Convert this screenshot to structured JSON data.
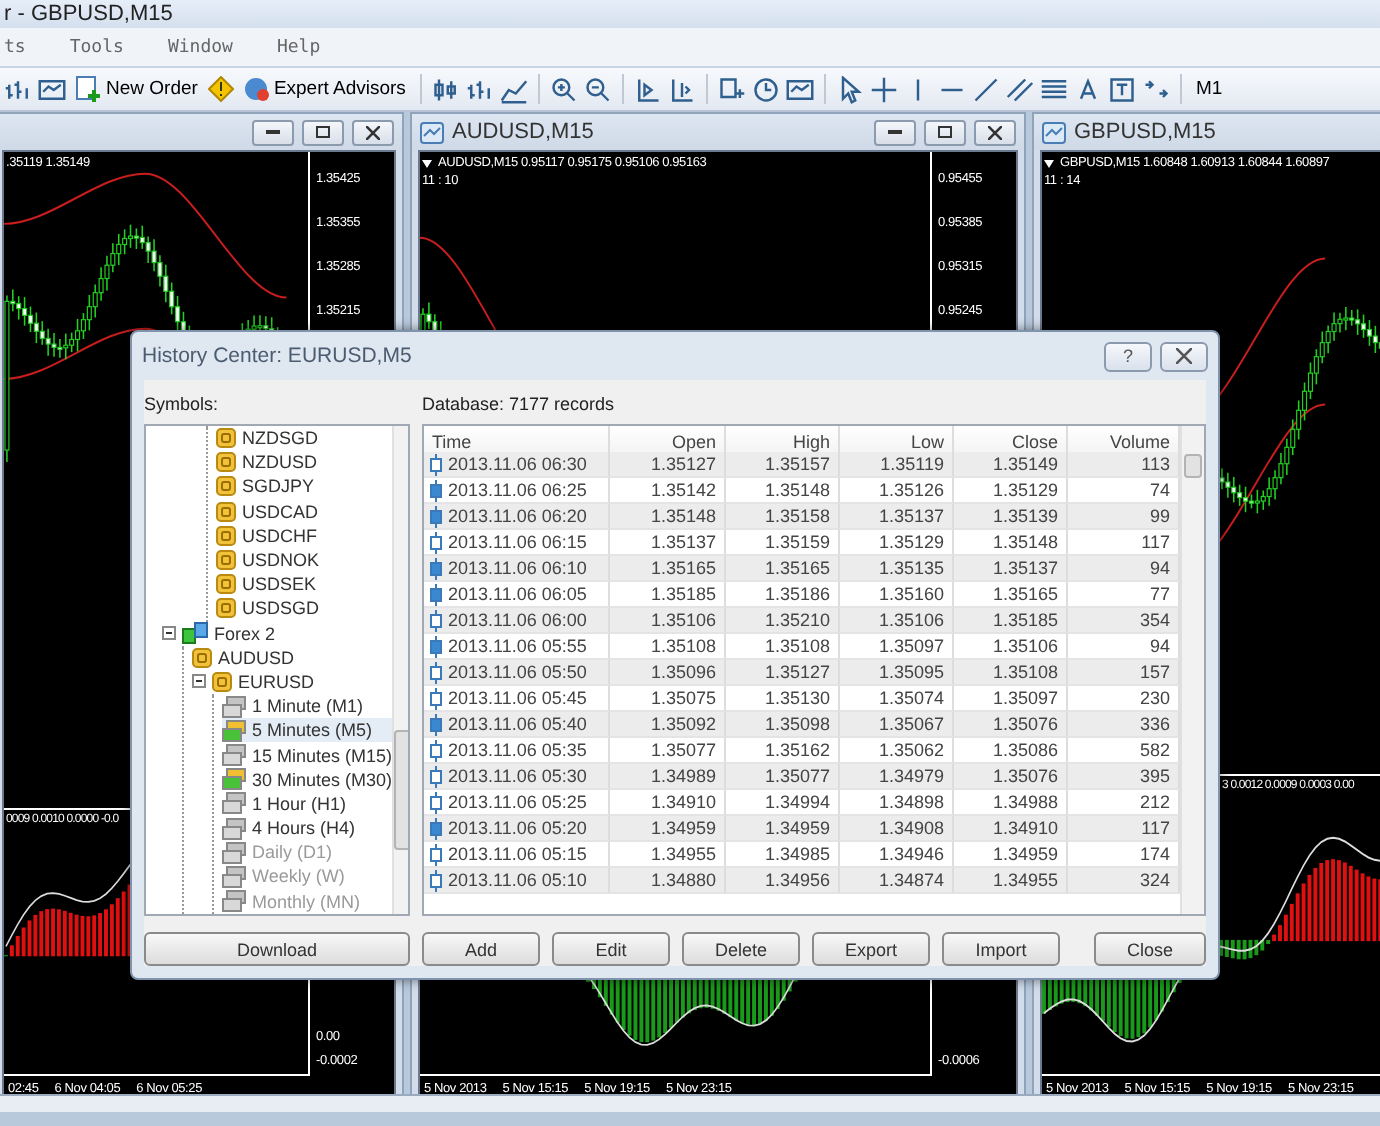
{
  "app_title": "r - GBPUSD,M15",
  "menu": [
    "ts",
    "Tools",
    "Window",
    "Help"
  ],
  "toolbar": {
    "new_order": "New Order",
    "expert_advisors": "Expert Advisors",
    "timeframe": "M1"
  },
  "charts": [
    {
      "window_buttons": true,
      "info": ".35119 1.35149",
      "price_labels": [
        "1.35425",
        "1.35355",
        "1.35285",
        "1.35215"
      ],
      "indicator_info": "0009 0.0010 0.0000 -0.0",
      "indicator_labels": [
        "0.00",
        "-0.0002"
      ],
      "time_labels": [
        "02:45",
        "6 Nov 04:05",
        "6 Nov 05:25"
      ]
    },
    {
      "title": "AUDUSD,M15",
      "window_buttons": true,
      "info": "AUDUSD,M15  0.95117 0.95175 0.95106 0.95163",
      "clock": "11 : 10",
      "price_labels": [
        "0.95455",
        "0.95385",
        "0.95315",
        "0.95245"
      ],
      "indicator_labels": [
        "-0.0006"
      ],
      "time_labels": [
        "5 Nov 2013",
        "5 Nov 15:15",
        "5 Nov 19:15",
        "5 Nov 23:15"
      ]
    },
    {
      "title": "GBPUSD,M15",
      "window_buttons": false,
      "info": "GBPUSD,M15  1.60848 1.60913 1.60844 1.60897",
      "clock": "11 : 14",
      "indicator_info": "3 0.0012 0.0009 0.0003 0.00",
      "time_labels": [
        "5 Nov 2013",
        "5 Nov 15:15",
        "5 Nov 19:15",
        "5 Nov 23:15"
      ]
    }
  ],
  "dialog": {
    "title": "History Center: EURUSD,M5",
    "help": "?",
    "symbols_label": "Symbols:",
    "database_label": "Database: 7177 records",
    "tree": [
      {
        "kind": "group",
        "children": [
          {
            "kind": "symbol",
            "label": "NZDSGD"
          },
          {
            "kind": "symbol",
            "label": "NZDUSD"
          },
          {
            "kind": "symbol",
            "label": "SGDJPY"
          },
          {
            "kind": "symbol",
            "label": "USDCAD"
          },
          {
            "kind": "symbol",
            "label": "USDCHF"
          },
          {
            "kind": "symbol",
            "label": "USDNOK"
          },
          {
            "kind": "symbol",
            "label": "USDSEK"
          },
          {
            "kind": "symbol",
            "label": "USDSGD"
          }
        ]
      },
      {
        "kind": "group",
        "label": "Forex 2",
        "expanded": true,
        "children": [
          {
            "kind": "symbol",
            "label": "AUDUSD"
          },
          {
            "kind": "symbol",
            "label": "EURUSD",
            "expanded": true,
            "children": [
              {
                "kind": "period",
                "label": "1 Minute (M1)",
                "has_data": false,
                "disabled": false,
                "selected": false
              },
              {
                "kind": "period",
                "label": "5 Minutes (M5)",
                "has_data": true,
                "disabled": false,
                "selected": true
              },
              {
                "kind": "period",
                "label": "15 Minutes (M15)",
                "has_data": false,
                "disabled": false,
                "selected": false
              },
              {
                "kind": "period",
                "label": "30 Minutes (M30)",
                "has_data": true,
                "disabled": false,
                "selected": false
              },
              {
                "kind": "period",
                "label": "1 Hour (H1)",
                "has_data": false,
                "disabled": false,
                "selected": false
              },
              {
                "kind": "period",
                "label": "4 Hours (H4)",
                "has_data": false,
                "disabled": false,
                "selected": false
              },
              {
                "kind": "period",
                "label": "Daily (D1)",
                "has_data": false,
                "disabled": true,
                "selected": false
              },
              {
                "kind": "period",
                "label": "Weekly (W)",
                "has_data": false,
                "disabled": true,
                "selected": false
              },
              {
                "kind": "period",
                "label": "Monthly (MN)",
                "has_data": false,
                "disabled": true,
                "selected": false
              }
            ]
          }
        ]
      }
    ],
    "download": "Download",
    "columns": [
      "Time",
      "Open",
      "High",
      "Low",
      "Close",
      "Volume"
    ],
    "rows": [
      {
        "kind": "bullish",
        "cells": [
          "2013.11.06 06:30",
          "1.35127",
          "1.35157",
          "1.35119",
          "1.35149",
          "113"
        ]
      },
      {
        "kind": "bearish",
        "cells": [
          "2013.11.06 06:25",
          "1.35142",
          "1.35148",
          "1.35126",
          "1.35129",
          "74"
        ]
      },
      {
        "kind": "bearish",
        "cells": [
          "2013.11.06 06:20",
          "1.35148",
          "1.35158",
          "1.35137",
          "1.35139",
          "99"
        ]
      },
      {
        "kind": "bullish",
        "cells": [
          "2013.11.06 06:15",
          "1.35137",
          "1.35159",
          "1.35129",
          "1.35148",
          "117"
        ]
      },
      {
        "kind": "bearish",
        "cells": [
          "2013.11.06 06:10",
          "1.35165",
          "1.35165",
          "1.35135",
          "1.35137",
          "94"
        ]
      },
      {
        "kind": "bearish",
        "cells": [
          "2013.11.06 06:05",
          "1.35185",
          "1.35186",
          "1.35160",
          "1.35165",
          "77"
        ]
      },
      {
        "kind": "bullish",
        "cells": [
          "2013.11.06 06:00",
          "1.35106",
          "1.35210",
          "1.35106",
          "1.35185",
          "354"
        ]
      },
      {
        "kind": "bearish",
        "cells": [
          "2013.11.06 05:55",
          "1.35108",
          "1.35108",
          "1.35097",
          "1.35106",
          "94"
        ]
      },
      {
        "kind": "bullish",
        "cells": [
          "2013.11.06 05:50",
          "1.35096",
          "1.35127",
          "1.35095",
          "1.35108",
          "157"
        ]
      },
      {
        "kind": "bullish",
        "cells": [
          "2013.11.06 05:45",
          "1.35075",
          "1.35130",
          "1.35074",
          "1.35097",
          "230"
        ]
      },
      {
        "kind": "bearish",
        "cells": [
          "2013.11.06 05:40",
          "1.35092",
          "1.35098",
          "1.35067",
          "1.35076",
          "336"
        ]
      },
      {
        "kind": "bullish",
        "cells": [
          "2013.11.06 05:35",
          "1.35077",
          "1.35162",
          "1.35062",
          "1.35086",
          "582"
        ]
      },
      {
        "kind": "bullish",
        "cells": [
          "2013.11.06 05:30",
          "1.34989",
          "1.35077",
          "1.34979",
          "1.35076",
          "395"
        ]
      },
      {
        "kind": "bullish",
        "cells": [
          "2013.11.06 05:25",
          "1.34910",
          "1.34994",
          "1.34898",
          "1.34988",
          "212"
        ]
      },
      {
        "kind": "bearish",
        "cells": [
          "2013.11.06 05:20",
          "1.34959",
          "1.34959",
          "1.34908",
          "1.34910",
          "117"
        ]
      },
      {
        "kind": "bullish",
        "cells": [
          "2013.11.06 05:15",
          "1.34955",
          "1.34985",
          "1.34946",
          "1.34959",
          "174"
        ]
      },
      {
        "kind": "bullish",
        "cells": [
          "2013.11.06 05:10",
          "1.34880",
          "1.34956",
          "1.34874",
          "1.34955",
          "324"
        ]
      }
    ],
    "buttons": [
      "Add",
      "Edit",
      "Delete",
      "Export",
      "Import",
      "Close"
    ]
  }
}
